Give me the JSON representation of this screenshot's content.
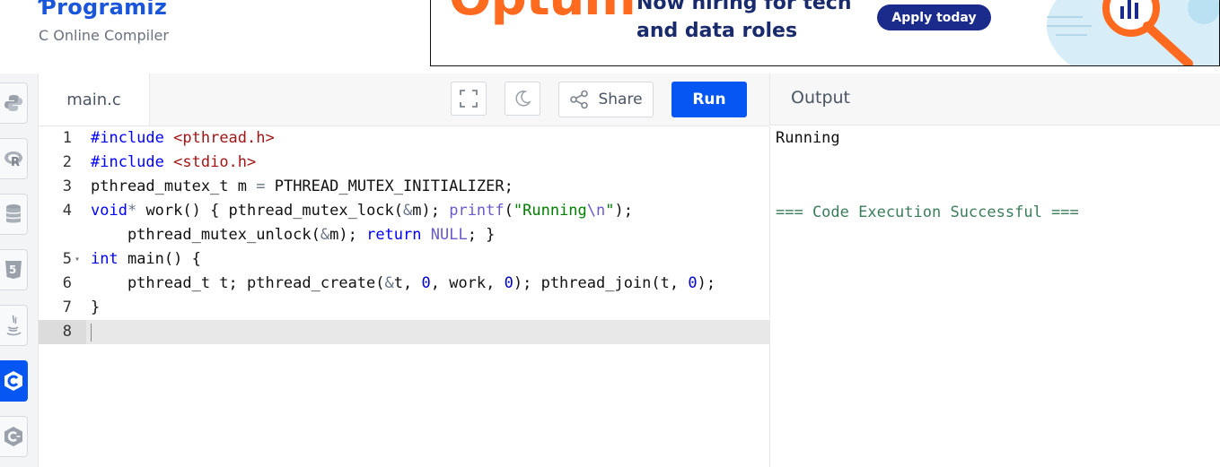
{
  "header": {
    "logo_text": "rogramiz",
    "subtitle": "C Online Compiler"
  },
  "ad": {
    "brand": "Optum",
    "line1": "Now hiring for tech",
    "line2": "and data roles",
    "cta": "Apply today"
  },
  "sidebar": {
    "languages": [
      {
        "name": "python-icon"
      },
      {
        "name": "r-icon"
      },
      {
        "name": "sql-icon"
      },
      {
        "name": "html-icon"
      },
      {
        "name": "java-icon"
      },
      {
        "name": "c-icon",
        "active": true
      },
      {
        "name": "cpp-icon"
      }
    ]
  },
  "editor": {
    "file_name": "main.c",
    "share_label": "Share",
    "run_label": "Run",
    "line_numbers": [
      "1",
      "2",
      "3",
      "4",
      "",
      "5",
      "6",
      "7",
      "8"
    ]
  },
  "output": {
    "title": "Output",
    "line1": "Running",
    "line2": "=== Code Execution Successful ==="
  },
  "colors": {
    "brand_blue": "#0556f3",
    "ad_orange": "#ff6a1f",
    "ad_navy": "#1a2b6d"
  }
}
